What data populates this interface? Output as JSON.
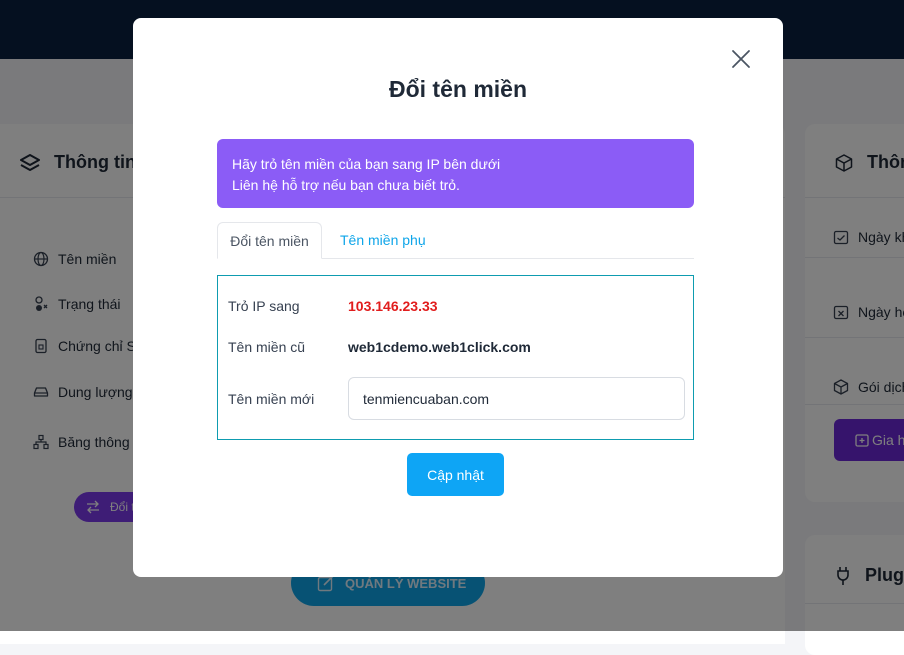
{
  "background": {
    "left_card": {
      "title": "Thông tin",
      "rows": [
        {
          "icon": "globe-icon",
          "label": "Tên miền"
        },
        {
          "icon": "status-icon",
          "label": "Trạng thái"
        },
        {
          "icon": "certificate-icon",
          "label": "Chứng chỉ SS"
        },
        {
          "icon": "storage-icon",
          "label": "Dung lượng"
        },
        {
          "icon": "network-icon",
          "label": "Băng thông"
        }
      ],
      "change_button": "Đổi t",
      "manage_button": "QUẢN LÝ WEBSITE"
    },
    "right_card": {
      "title": "Thôn",
      "rows": [
        {
          "icon": "calendar-check-icon",
          "label": "Ngày kh"
        },
        {
          "icon": "calendar-x-icon",
          "label": "Ngày hế"
        },
        {
          "icon": "package-icon",
          "label": "Gói dịch"
        }
      ],
      "renew_button": "Gia h"
    },
    "plugin_card": {
      "title": "Plug"
    }
  },
  "modal": {
    "title": "Đổi tên miền",
    "alert_line1": "Hãy trỏ tên miền của bạn sang IP bên dưới",
    "alert_line2": "Liên hệ hỗ trợ nếu bạn chưa biết trỏ.",
    "tabs": [
      {
        "label": "Đổi tên miền",
        "active": true
      },
      {
        "label": "Tên miền phụ",
        "active": false
      }
    ],
    "form": {
      "ip_label": "Trỏ IP sang",
      "ip_value": "103.146.23.33",
      "old_label": "Tên miền cũ",
      "old_value": "web1cdemo.web1click.com",
      "new_label": "Tên miền mới",
      "new_placeholder": "tenmiencuaban.com"
    },
    "submit_label": "Cập nhật"
  },
  "colors": {
    "topbar": "#0b2140",
    "alert": "#8b5cf6",
    "primary": "#0ea5f5",
    "ip_red": "#e11d1d",
    "form_border": "#0e9cb0"
  }
}
